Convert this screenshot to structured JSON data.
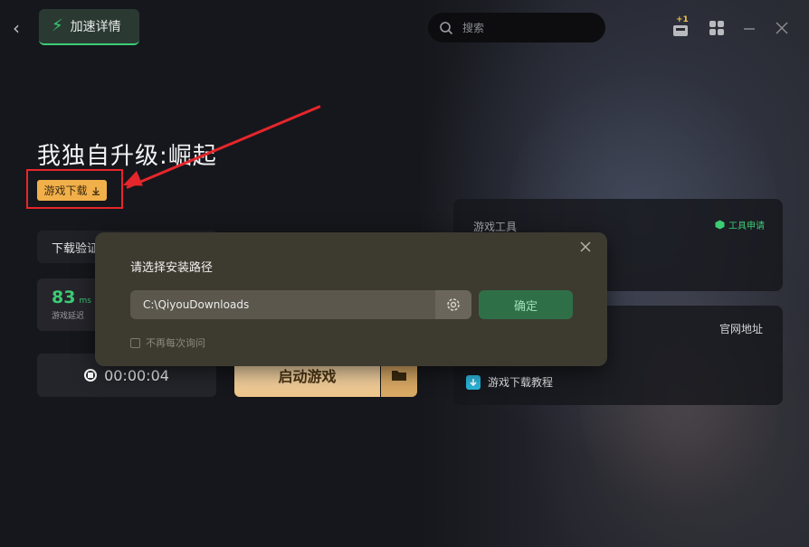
{
  "header": {
    "tab_label": "加速详情",
    "search_placeholder": "搜索",
    "notification_badge": "+1"
  },
  "game": {
    "title": "我独自升级:崛起",
    "download_label": "游戏下载"
  },
  "left": {
    "verify_label": "下载验证",
    "latency_value": "83",
    "latency_unit": "ms",
    "latency_caption": "游戏延迟",
    "timer": "00:00:04",
    "launch_label": "启动游戏"
  },
  "right": {
    "tools_heading": "游戏工具",
    "tools_apply": "工具申请",
    "official_site": "官网地址",
    "tutorial_label": "游戏下载教程"
  },
  "dialog": {
    "title": "请选择安装路径",
    "path_value": "C:\\QiyouDownloads",
    "confirm_label": "确定",
    "dont_ask_label": "不再每次询问"
  },
  "colors": {
    "accent_green": "#3ccc73",
    "download_orange": "#f2b04a",
    "annotation_red": "#e5262b"
  }
}
